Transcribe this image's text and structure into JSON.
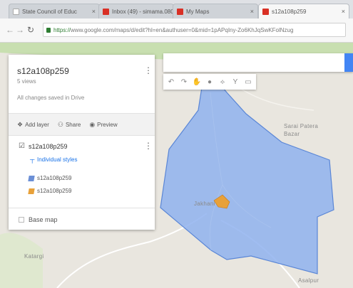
{
  "browser": {
    "tabs": [
      {
        "title": "State Council of Educ",
        "active": false,
        "favicon_color": "#ffffff"
      },
      {
        "title": "Inbox (49) - simama.080",
        "active": false,
        "favicon_color": "#d93025"
      },
      {
        "title": "My Maps",
        "active": false,
        "favicon_color": "#d93025"
      },
      {
        "title": "s12a108p259",
        "active": true,
        "favicon_color": "#d93025"
      }
    ],
    "url_scheme": "https://",
    "url_rest": "www.google.com/maps/d/edit?hl=en&authuser=0&mid=1pAPqIny-Zo6KhJqSwKFolNzug"
  },
  "panel": {
    "map_title": "s12a108p259",
    "views": "5 views",
    "save_status": "All changes saved in Drive",
    "actions": [
      {
        "label": "Add layer",
        "icon": "add-layer-icon"
      },
      {
        "label": "Share",
        "icon": "share-icon"
      },
      {
        "label": "Preview",
        "icon": "preview-icon"
      }
    ],
    "layer": {
      "name": "s12a108p259",
      "checked": true,
      "style_link": "Individual styles",
      "features": [
        {
          "name": "s12a108p259",
          "color": "#6b8fd6"
        },
        {
          "name": "s12a108p259",
          "color": "#e8a13a"
        }
      ]
    },
    "base_map": "Base map"
  },
  "map": {
    "labels": {
      "sarai": "Sarai Patera Bazar",
      "jakhani": "Jakhani",
      "katargi": "Katargi",
      "asalpur": "Asalpur"
    },
    "polygon_color": "#7fa6ea"
  }
}
